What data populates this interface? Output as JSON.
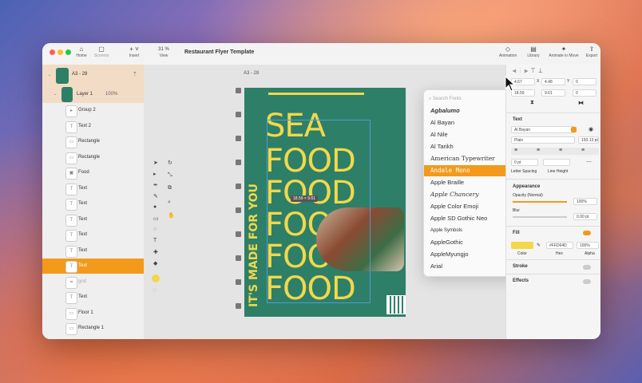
{
  "app": {
    "toolbar": {
      "home_label": "Home",
      "screens_label": "Screens",
      "insert_label": "Insert",
      "zoom_value": "31 %",
      "view_label": "View",
      "document_title": "Restaurant Flyer Template",
      "right_labels": {
        "animation_label": "Animation",
        "library_label": "Library",
        "animate_label": "Animate in Move",
        "export_label": "Export"
      }
    },
    "layers": {
      "artboard_name": "A3 - 28",
      "layer1_name": "Layer 1",
      "layer1_percent": "100%",
      "items": [
        {
          "name": "Group 2",
          "type": "group"
        },
        {
          "name": "Text 2",
          "type": "text"
        },
        {
          "name": "Rectangle",
          "type": "rect"
        },
        {
          "name": "Rectangle",
          "type": "rect"
        },
        {
          "name": "Food",
          "type": "image"
        },
        {
          "name": "Text",
          "type": "text"
        },
        {
          "name": "Text",
          "type": "text"
        },
        {
          "name": "Text",
          "type": "text"
        },
        {
          "name": "Text",
          "type": "text"
        },
        {
          "name": "Text",
          "type": "text"
        },
        {
          "name": "Text",
          "type": "text",
          "selected": true
        },
        {
          "name": "grid",
          "type": "grid"
        },
        {
          "name": "Text",
          "type": "text"
        },
        {
          "name": "Floor 1",
          "type": "floor"
        },
        {
          "name": "Rectangle 1",
          "type": "rect"
        }
      ]
    },
    "canvas": {
      "artboard_label": "A3 - 28",
      "poster_lines": [
        "SEA",
        "FOOD",
        "FOOD",
        "FOOD",
        "FOOD",
        "FOOD"
      ],
      "vertical_text": "IT'S MADE FOR YOU",
      "size_badge": "18.59 × 9.61",
      "colors": {
        "poster_bg": "#2e7f68",
        "poster_text": "#f2d84a",
        "accent": "#f39a1c"
      }
    },
    "font_dropdown": {
      "search_placeholder": "Search Fonts",
      "fonts": [
        "Agbalumo",
        "Al Bayan",
        "Al Nile",
        "Al Tarikh",
        "American Typewriter",
        "Andale Mono",
        "Apple Braille",
        "Apple Chancery",
        "Apple   Color   Emoji",
        "Apple SD Gothic Neo",
        "Apple Symbols",
        "AppleGothic",
        "AppleMyungjo",
        "Arial"
      ],
      "highlighted": "Andale Mono"
    },
    "inspector": {
      "x_value": "4.67",
      "x_label": "X",
      "y_value": "4.48",
      "y_label": "Y",
      "zero": "0",
      "w_value": "18.59",
      "h_value": "9.61",
      "rotation": "0",
      "text_section": "Text",
      "font_family": "Al Bayan",
      "font_style": "Plain",
      "font_size": "193.13 pt",
      "letter_spacing_value": "0 pt",
      "letter_spacing_label": "Letter Spacing",
      "line_height_label": "Line Height",
      "appearance_section": "Appearance",
      "opacity_label": "Opacity (Normal)",
      "opacity_value": "100%",
      "blur_label": "Blur",
      "blur_value": "0.00 pt",
      "fill_section": "Fill",
      "fill_hex": "#FFD64D",
      "fill_alpha": "100%",
      "fill_color_label": "Color",
      "fill_hex_label": "Hex",
      "fill_alpha_label": "Alpha",
      "stroke_section": "Stroke",
      "effects_section": "Effects"
    }
  }
}
